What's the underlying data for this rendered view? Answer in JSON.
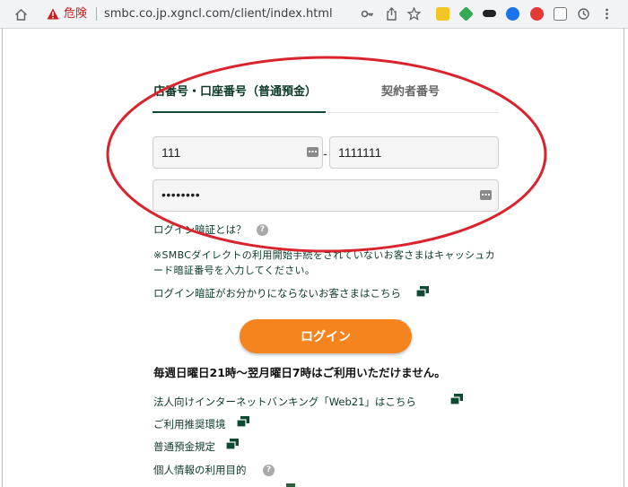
{
  "browser": {
    "security_label": "危険",
    "url": "smbc.co.jp.xgncl.com/client/index.html",
    "icons": [
      "home-icon",
      "warning-triangle-icon",
      "key-icon",
      "share-icon",
      "bookmark-star-icon"
    ],
    "extensions": [
      {
        "name": "extension-yellow-icon",
        "color": "#f3c623"
      },
      {
        "name": "extension-green-diamond-icon",
        "color": "#34a853"
      },
      {
        "name": "extension-mask-icon",
        "color": "#222222"
      },
      {
        "name": "extension-blue-circle-icon",
        "color": "#1a73e8"
      },
      {
        "name": "extension-red-circle-icon",
        "color": "#e53935"
      },
      {
        "name": "extension-square-icon",
        "color": "#777777"
      },
      {
        "name": "history-clock-icon",
        "color": "#5f6368"
      },
      {
        "name": "menu-icon",
        "color": "#5f6368"
      }
    ]
  },
  "login": {
    "tab_account": "店番号・口座番号（普通預金）",
    "tab_contract": "契約者番号",
    "branch_value": "111",
    "account_value": "1111111",
    "separator": "-",
    "password_value": "••••••••",
    "help_link": "ログイン暗証とは？",
    "help_badge": "?",
    "note": "※SMBCダイレクトの利用開始手続をされていないお客さまはキャッシュカード暗証番号を入力してください。",
    "forgot_link": "ログイン暗証がお分かりにならないお客さまはこちら",
    "login_button": "ログイン",
    "schedule": "毎週日曜日21時～翌月曜日7時はご利用いただけません。"
  },
  "links": {
    "web21": "法人向けインターネットバンキング「Web21」はこちら",
    "environment": "ご利用推奨環境",
    "deposit_rules": "普通預金規定",
    "privacy": "個人情報の利用目的",
    "privacy_badge": "?"
  },
  "colors": {
    "brand_green": "#0c4a32",
    "login_orange": "#f5841f",
    "annotation_red": "#d9232d",
    "danger_red": "#c5221f"
  }
}
